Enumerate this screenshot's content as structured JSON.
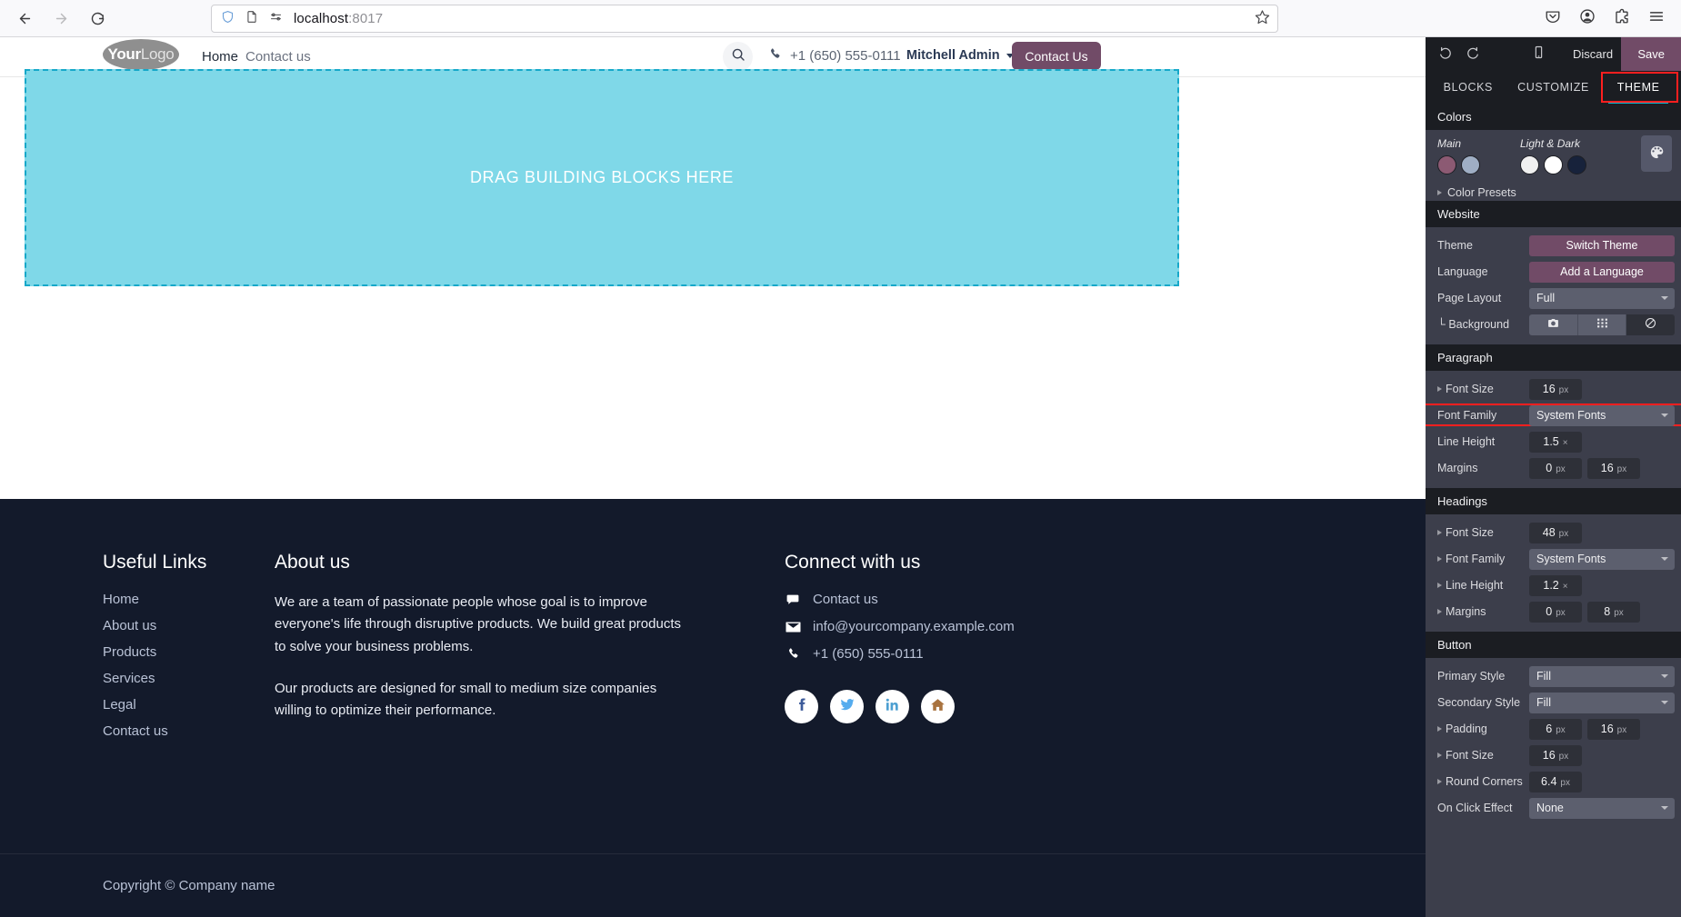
{
  "browser": {
    "back_icon": "arrow-left-icon",
    "forward_icon": "arrow-right-icon",
    "reload_icon": "reload-icon",
    "shield_icon": "shield-icon",
    "page_icon": "page-icon",
    "tracking_icon": "tracking-protection-icon",
    "url_host": "localhost",
    "url_port": ":8017",
    "bookmark_icon": "star-icon",
    "pocket_icon": "pocket-icon",
    "account_icon": "account-icon",
    "extensions_icon": "extensions-icon",
    "menu_icon": "hamburger-menu-icon"
  },
  "site_header": {
    "logo_part1": "Your",
    "logo_part2": "Logo",
    "nav": [
      {
        "label": "Home",
        "active": true
      },
      {
        "label": "Contact us",
        "active": false
      }
    ],
    "search_icon": "search-icon",
    "phone_icon": "phone-icon",
    "phone": "+1 (650) 555-0111",
    "user_name": "Mitchell Admin",
    "user_caret_icon": "chevron-down-icon",
    "cta_label": "Contact Us",
    "cta_color": "#714B67"
  },
  "drop_zone": {
    "label": "DRAG BUILDING BLOCKS HERE",
    "fill_color": "#7FD8E8",
    "border_color": "#16a8c9"
  },
  "footer": {
    "background": "#131A2B",
    "useful_links": {
      "title": "Useful Links",
      "items": [
        "Home",
        "About us",
        "Products",
        "Services",
        "Legal",
        "Contact us"
      ]
    },
    "about": {
      "title": "About us",
      "paragraph1": "We are a team of passionate people whose goal is to improve everyone's life through disruptive products. We build great products to solve your business problems.",
      "paragraph2": "Our products are designed for small to medium size companies willing to optimize their performance."
    },
    "connect": {
      "title": "Connect with us",
      "rows": [
        {
          "icon": "chat-bubble-icon",
          "label": "Contact us"
        },
        {
          "icon": "envelope-icon",
          "label": "info@yourcompany.example.com"
        },
        {
          "icon": "phone-icon",
          "label": "+1 (650) 555-0111"
        }
      ],
      "social": [
        {
          "icon": "facebook-icon",
          "color": "#3C5A99"
        },
        {
          "icon": "twitter-icon",
          "color": "#55ACEE"
        },
        {
          "icon": "linkedin-icon",
          "color": "#4C9FD1"
        },
        {
          "icon": "home-icon",
          "color": "#A9733F"
        }
      ]
    },
    "copyright": "Copyright © Company name"
  },
  "editor": {
    "topbar": {
      "undo_icon": "undo-icon",
      "redo_icon": "redo-icon",
      "mobile_icon": "mobile-preview-icon",
      "discard_label": "Discard",
      "save_label": "Save",
      "save_color": "#714B67"
    },
    "tabs": [
      {
        "label": "BLOCKS",
        "active": false
      },
      {
        "label": "CUSTOMIZE",
        "active": false
      },
      {
        "label": "THEME",
        "active": true,
        "highlighted": true
      }
    ],
    "colors": {
      "section_title": "Colors",
      "main_label": "Main",
      "light_dark_label": "Light & Dark",
      "main_swatches": [
        "#8C5A73",
        "#9FAEC4"
      ],
      "light_dark_swatches": [
        "#F0F0F0",
        "#FFFFFF",
        "#17223B"
      ],
      "palette_icon": "palette-icon",
      "presets_label": "Color Presets",
      "presets_expander_icon": "triangle-right-icon"
    },
    "website": {
      "section_title": "Website",
      "theme_label": "Theme",
      "theme_button": "Switch Theme",
      "language_label": "Language",
      "language_button": "Add a Language",
      "page_layout_label": "Page Layout",
      "page_layout_value": "Full",
      "background_label": "└ Background",
      "background_options": [
        {
          "icon": "camera-icon",
          "active": false
        },
        {
          "icon": "grid-pattern-icon",
          "active": false
        },
        {
          "icon": "none-slash-icon",
          "active": true
        }
      ]
    },
    "paragraph": {
      "section_title": "Paragraph",
      "font_size_label": "Font Size",
      "font_size_value": "16",
      "font_size_unit": "px",
      "font_family_label": "Font Family",
      "font_family_value": "System Fonts",
      "font_family_highlighted": true,
      "line_height_label": "Line Height",
      "line_height_value": "1.5",
      "line_height_unit": "×",
      "margins_label": "Margins",
      "margin_top_value": "0",
      "margin_top_unit": "px",
      "margin_bottom_value": "16",
      "margin_bottom_unit": "px"
    },
    "headings": {
      "section_title": "Headings",
      "font_size_label": "Font Size",
      "font_size_value": "48",
      "font_size_unit": "px",
      "font_family_label": "Font Family",
      "font_family_value": "System Fonts",
      "line_height_label": "Line Height",
      "line_height_value": "1.2",
      "line_height_unit": "×",
      "margins_label": "Margins",
      "margin_top_value": "0",
      "margin_top_unit": "px",
      "margin_bottom_value": "8",
      "margin_bottom_unit": "px"
    },
    "button": {
      "section_title": "Button",
      "primary_style_label": "Primary Style",
      "primary_style_value": "Fill",
      "secondary_style_label": "Secondary Style",
      "secondary_style_value": "Fill",
      "padding_label": "Padding",
      "padding_v_value": "6",
      "padding_v_unit": "px",
      "padding_h_value": "16",
      "padding_h_unit": "px",
      "font_size_label": "Font Size",
      "font_size_value": "16",
      "font_size_unit": "px",
      "round_corners_label": "Round Corners",
      "round_corners_value": "6.4",
      "round_corners_unit": "px",
      "on_click_label": "On Click Effect",
      "on_click_value": "None"
    },
    "highlight_color": "#ff1f1f"
  }
}
